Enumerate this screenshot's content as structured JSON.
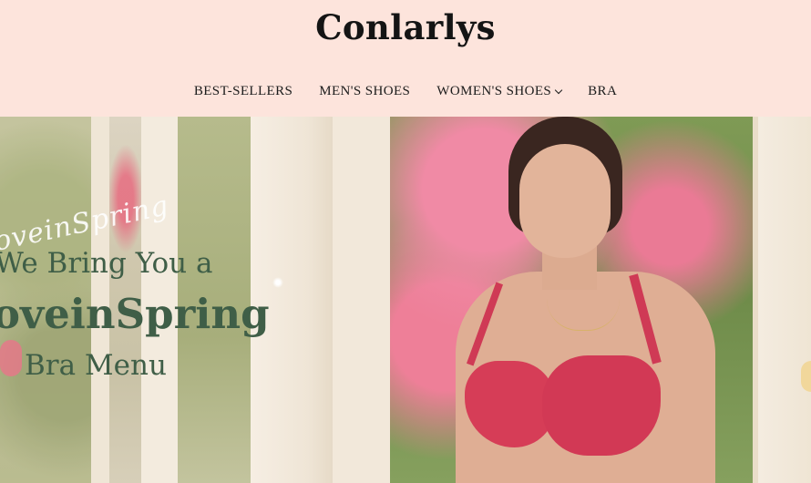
{
  "header": {
    "logo": "Conlarlys",
    "nav": [
      {
        "label": "BEST-SELLERS",
        "has_dropdown": false
      },
      {
        "label": "MEN'S SHOES",
        "has_dropdown": false
      },
      {
        "label": "WOMEN'S SHOES",
        "has_dropdown": true,
        "dropdown_icon": "chevron-down-icon"
      },
      {
        "label": "BRA",
        "has_dropdown": false
      }
    ]
  },
  "hero": {
    "script_text": "oveinSpring",
    "line1": "We Bring You a",
    "line2": "oveinSpring",
    "line3": "Bra Menu"
  },
  "colors": {
    "header_bg": "#fde4dc",
    "headline_green": "#3f5e47",
    "bra_red": "#d23955"
  }
}
